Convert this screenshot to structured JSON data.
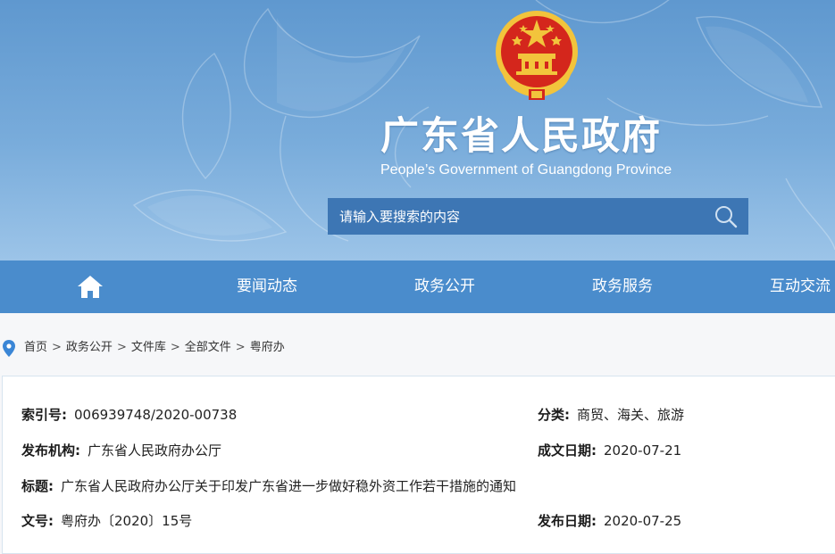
{
  "header": {
    "title": "广东省人民政府",
    "subtitle": "People’s Government of Guangdong Province",
    "search_placeholder": "请输入要搜索的内容"
  },
  "nav": {
    "items": [
      {
        "label": "要闻动态"
      },
      {
        "label": "政务公开"
      },
      {
        "label": "政务服务"
      },
      {
        "label": "互动交流"
      }
    ]
  },
  "breadcrumb": [
    "首页",
    "政务公开",
    "文件库",
    "全部文件",
    "粤府办"
  ],
  "breadcrumb_separator": ">",
  "document_meta": {
    "index_no": {
      "label": "索引号:",
      "value": "006939748/2020-00738"
    },
    "category": {
      "label": "分类:",
      "value": "商贸、海关、旅游"
    },
    "issuer": {
      "label": "发布机构:",
      "value": "广东省人民政府办公厅"
    },
    "written_date": {
      "label": "成文日期:",
      "value": "2020-07-21"
    },
    "title": {
      "label": "标题:",
      "value": "广东省人民政府办公厅关于印发广东省进一步做好稳外资工作若干措施的通知"
    },
    "doc_no": {
      "label": "文号:",
      "value": "粤府办〔2020〕15号"
    },
    "publish_date": {
      "label": "发布日期:",
      "value": "2020-07-25"
    }
  },
  "colors": {
    "nav_bg": "#4a8ccc",
    "search_bg": "#3d76b4",
    "emblem_red": "#d4261c",
    "emblem_gold": "#f2c43c",
    "pin_blue": "#3a86d6"
  },
  "icons": {
    "home": "home-icon",
    "search": "search-icon",
    "location": "location-pin-icon",
    "emblem": "national-emblem"
  }
}
